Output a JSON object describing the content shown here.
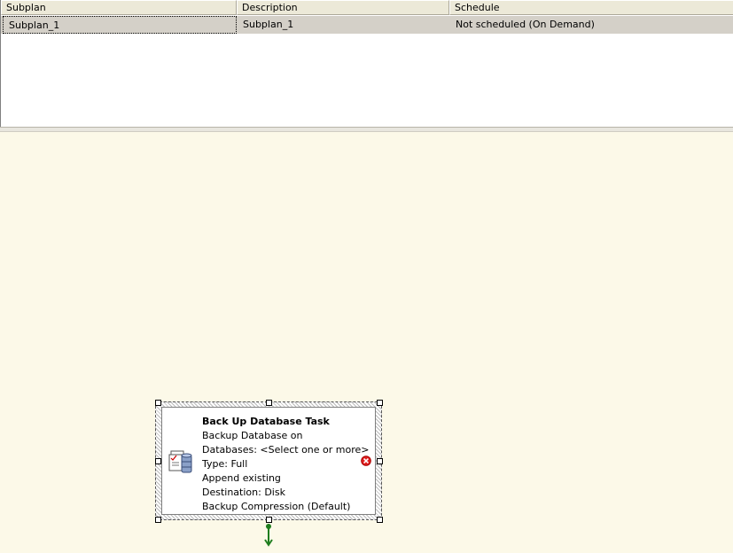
{
  "grid": {
    "columns": [
      "Subplan",
      "Description",
      "Schedule"
    ],
    "rows": [
      {
        "subplan": "Subplan_1",
        "description": "Subplan_1",
        "schedule": "Not scheduled (On Demand)"
      }
    ]
  },
  "task": {
    "title": "Back Up Database Task",
    "lines": [
      "Backup Database on",
      "Databases: <Select one or more>",
      "Type: Full",
      "Append existing",
      "Destination: Disk",
      "Backup Compression (Default)"
    ],
    "icon": "backup-database-icon",
    "status_icon": "error-icon"
  },
  "colors": {
    "canvas": "#fcf9e8",
    "row_selected": "#d4d0c8",
    "header": "#ece9d8",
    "error": "#e02020",
    "connector": "#1e7d1e"
  }
}
